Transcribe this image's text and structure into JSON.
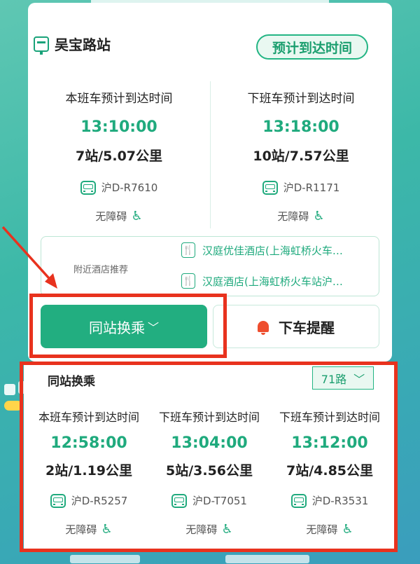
{
  "stop": {
    "name": "吴宝路站",
    "eta_button": "预计到达时间"
  },
  "arrivals": [
    {
      "label": "本班车预计到达时间",
      "time": "13:10:00",
      "distance": "7站/5.07公里",
      "plate": "沪D-R7610",
      "access": "无障碍"
    },
    {
      "label": "下班车预计到达时间",
      "time": "13:18:00",
      "distance": "10站/7.57公里",
      "plate": "沪D-R1171",
      "access": "无障碍"
    }
  ],
  "hotels": {
    "label": "附近酒店推荐",
    "items": [
      "汉庭优佳酒店(上海虹桥火车…",
      "汉庭酒店(上海虹桥火车站沪…"
    ]
  },
  "actions": {
    "transfer": "同站换乘",
    "remind": "下车提醒"
  },
  "transfer_panel": {
    "title": "同站换乘",
    "route": "71路",
    "arrivals": [
      {
        "label": "本班车预计到达时间",
        "time": "12:58:00",
        "distance": "2站/1.19公里",
        "plate": "沪D-R5257",
        "access": "无障碍"
      },
      {
        "label": "下班车预计到达时间",
        "time": "13:04:00",
        "distance": "5站/3.56公里",
        "plate": "沪D-T7051",
        "access": "无障碍"
      },
      {
        "label": "下班车预计到达时间",
        "time": "13:12:00",
        "distance": "7站/4.85公里",
        "plate": "沪D-R3531",
        "access": "无障碍"
      }
    ]
  },
  "colors": {
    "accent": "#22ae80",
    "highlight": "#e8321e",
    "bell": "#ee4e2e"
  },
  "icons": [
    "bus-stop-icon",
    "bus-icon",
    "wheelchair-icon",
    "restaurant-icon",
    "bell-icon",
    "chevron-down-icon"
  ]
}
